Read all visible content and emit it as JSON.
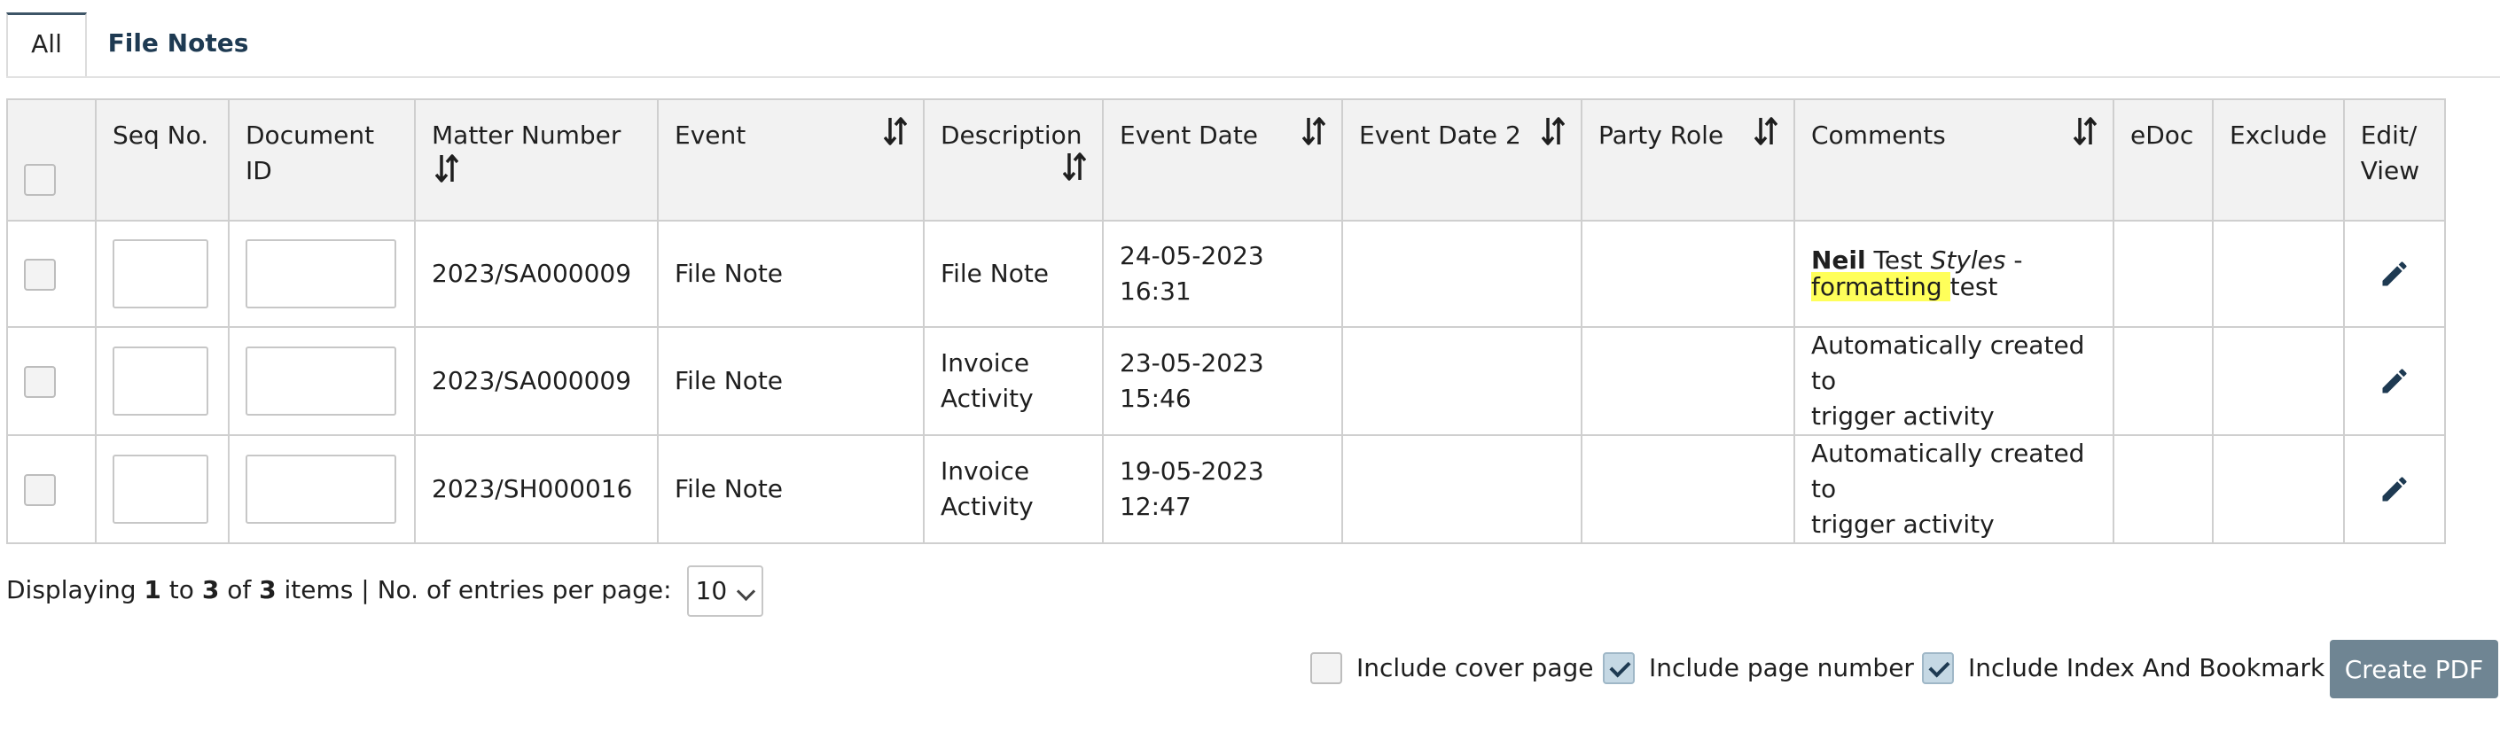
{
  "tabs": [
    {
      "label": "All",
      "active": true
    },
    {
      "label": "File Notes",
      "active": false
    }
  ],
  "table": {
    "headers": {
      "seq_no": "Seq No.",
      "document_id": "Document ID",
      "matter_number": "Matter Number",
      "event": "Event",
      "description": "Description",
      "event_date": "Event Date",
      "event_date_2": "Event Date 2",
      "party_role": "Party Role",
      "comments": "Comments",
      "edoc": "eDoc",
      "exclude": "Exclude",
      "edit_view_1": "Edit/",
      "edit_view_2": "View"
    },
    "rows": [
      {
        "matter_number": "2023/SA000009",
        "event": "File Note",
        "description": "File Note",
        "event_date": "24-05-2023\n16:31",
        "comments_rich": {
          "bold": "Neil",
          "plain1": " Test ",
          "italic": "Styles",
          "plain2": " -",
          "highlight": "formatting ",
          "plain3": "test"
        }
      },
      {
        "matter_number": "2023/SA000009",
        "event": "File Note",
        "description": "Invoice\nActivity",
        "event_date": "23-05-2023\n15:46",
        "comments": "Automatically created to\ntrigger activity"
      },
      {
        "matter_number": "2023/SH000016",
        "event": "File Note",
        "description": "Invoice\nActivity",
        "event_date": "19-05-2023\n12:47",
        "comments": "Automatically created to\ntrigger activity"
      }
    ]
  },
  "footer": {
    "displaying_prefix": "Displaying ",
    "from": "1",
    "to_word": " to ",
    "to": "3",
    "of_word": " of ",
    "total": "3",
    "suffix": " items | No. of entries per page:",
    "per_page": "10"
  },
  "options": {
    "include_cover_page": {
      "label": "Include cover page",
      "checked": false
    },
    "include_page_number": {
      "label": "Include page number",
      "checked": true
    },
    "include_index_bookmark": {
      "label": "Include Index And Bookmark",
      "checked": true
    }
  },
  "create_pdf_label": "Create PDF",
  "colors": {
    "header_bg": "#f2f2f2",
    "accent": "#1e3a52",
    "button": "#6f8593",
    "highlight": "#ffff5a"
  }
}
